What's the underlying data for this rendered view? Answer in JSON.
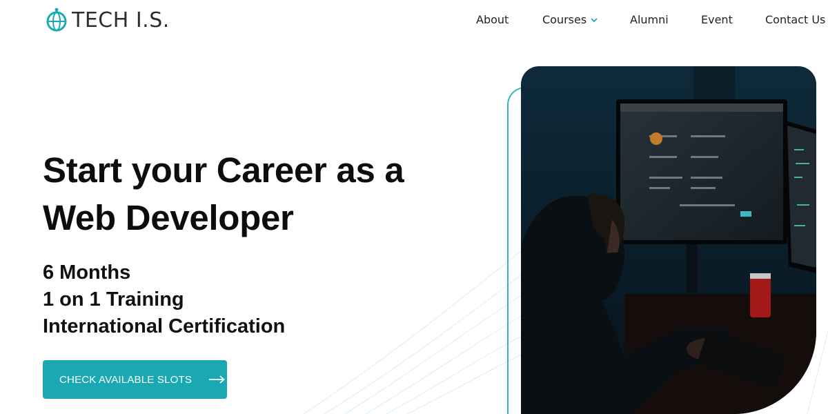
{
  "brand": {
    "name": "TECH I.S.",
    "logo_icon": "globe-pin-icon",
    "accent_color": "#1aa9b2"
  },
  "nav": {
    "items": [
      {
        "label": "About"
      },
      {
        "label": "Courses",
        "has_dropdown": true
      },
      {
        "label": "Alumni"
      },
      {
        "label": "Event"
      },
      {
        "label": "Contact Us"
      }
    ]
  },
  "hero": {
    "title_line1": "Start your Career as a",
    "title_line2": "Web Developer",
    "features": [
      "6 Months",
      "1 on 1 Training",
      "International Certification"
    ],
    "cta_label": "CHECK AVAILABLE SLOTS",
    "cta_icon": "arrow-right-icon",
    "image": "developer-at-monitors-photo"
  }
}
